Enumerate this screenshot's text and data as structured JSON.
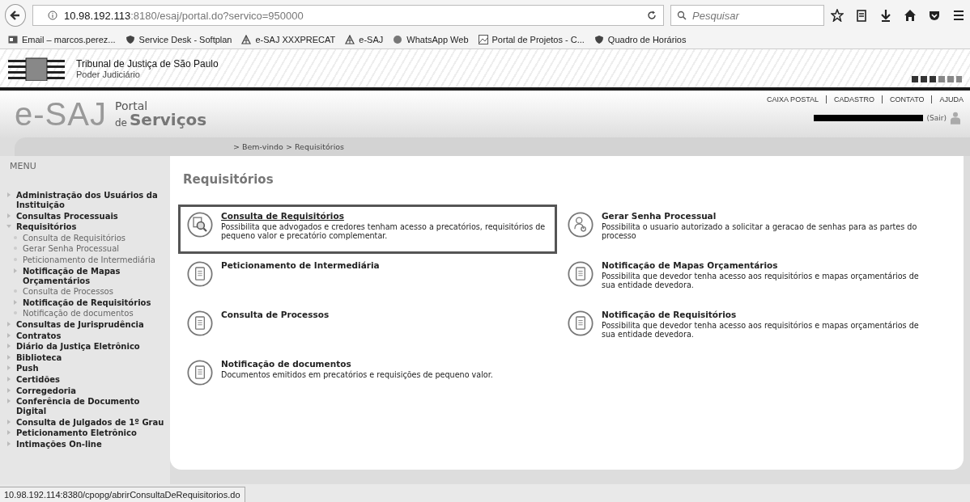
{
  "browser": {
    "url_host": "10.98.192.113",
    "url_rest": ":8180/esaj/portal.do?servico=950000",
    "search": {
      "placeholder": "Pesquisar"
    },
    "bookmarks": [
      {
        "label": "Email – marcos.perez...",
        "kind": "mail"
      },
      {
        "label": "Service Desk - Softplan",
        "kind": "shield"
      },
      {
        "label": "e-SAJ XXXPRECAT",
        "kind": "scale"
      },
      {
        "label": "e-SAJ",
        "kind": "scale"
      },
      {
        "label": "WhatsApp Web",
        "kind": "chat"
      },
      {
        "label": "Portal de Projetos - C...",
        "kind": "image"
      },
      {
        "label": "Quadro de Horários",
        "kind": "shield"
      }
    ]
  },
  "court": {
    "title": "Tribunal de Justiça de São Paulo",
    "subtitle": "Poder Judiciário"
  },
  "portal": {
    "logo": "e-SAJ",
    "logo_small": "Portal",
    "logo_de": "de",
    "logo_big": "Serviços",
    "top_links": [
      "CAIXA POSTAL",
      "CADASTRO",
      "CONTATO",
      "AJUDA"
    ],
    "logout": "(Sair)",
    "breadcrumb": "> Bem-vindo > Requisitórios"
  },
  "menu": {
    "title": "MENU",
    "items": [
      {
        "label": "Administração dos Usuários da Instituição",
        "kind": "folder",
        "expanded": false
      },
      {
        "label": "Consultas Processuais",
        "kind": "folder",
        "expanded": false
      },
      {
        "label": "Requisitórios",
        "kind": "folder",
        "expanded": true,
        "children": [
          {
            "label": "Consulta de Requisitórios",
            "kind": "leaf"
          },
          {
            "label": "Gerar Senha Processual",
            "kind": "leaf"
          },
          {
            "label": "Peticionamento de Intermediária",
            "kind": "leaf"
          },
          {
            "label": "Notificação de Mapas Orçamentários",
            "kind": "folder",
            "expanded": false
          },
          {
            "label": "Consulta de Processos",
            "kind": "leaf"
          },
          {
            "label": "Notificação de Requisitórios",
            "kind": "folder",
            "expanded": false
          },
          {
            "label": "Notificação de documentos",
            "kind": "leaf"
          }
        ]
      },
      {
        "label": "Consultas de Jurisprudência",
        "kind": "folder",
        "expanded": false
      },
      {
        "label": "Contratos",
        "kind": "folder",
        "expanded": false
      },
      {
        "label": "Diário da Justiça Eletrônico",
        "kind": "folder",
        "expanded": false
      },
      {
        "label": "Biblioteca",
        "kind": "folder",
        "expanded": false
      },
      {
        "label": "Push",
        "kind": "folder",
        "expanded": false
      },
      {
        "label": "Certidões",
        "kind": "folder",
        "expanded": false
      },
      {
        "label": "Corregedoria",
        "kind": "folder",
        "expanded": false
      },
      {
        "label": "Conferência de Documento Digital",
        "kind": "folder",
        "expanded": false
      },
      {
        "label": "Consulta de Julgados de 1º Grau",
        "kind": "folder",
        "expanded": false
      },
      {
        "label": "Peticionamento Eletrônico",
        "kind": "folder",
        "expanded": false
      },
      {
        "label": "Intimações On-line",
        "kind": "folder",
        "expanded": false
      }
    ]
  },
  "content": {
    "title": "Requisitórios",
    "services": [
      {
        "title": "Consulta de Requisitórios",
        "description": "Possibilita que advogados e credores tenham acesso a precatórios, requisitórios de pequeno valor e precatório complementar.",
        "kind": "search",
        "selected": true
      },
      {
        "title": "Gerar Senha Processual",
        "description": "Possibilita o usuario autorizado a solicitar a geracao de senhas para as partes do processo",
        "kind": "key",
        "selected": false
      },
      {
        "title": "Peticionamento de Intermediária",
        "kind": "doc",
        "selected": false
      },
      {
        "title": "Notificação de Mapas Orçamentários",
        "description": "Possibilita que devedor tenha acesso aos requisitórios e mapas orçamentários de sua entidade devedora.",
        "kind": "doc",
        "selected": false
      },
      {
        "title": "Consulta de Processos",
        "kind": "doc",
        "selected": false
      },
      {
        "title": "Notificação de Requisitórios",
        "description": "Possibilita que devedor tenha acesso aos requisitórios e mapas orçamentários de sua entidade devedora.",
        "kind": "doc",
        "selected": false
      },
      {
        "title": "Notificação de documentos",
        "description": "Documentos emitidos em precatórios e requisições de pequeno valor.",
        "kind": "doc",
        "selected": false
      }
    ]
  },
  "status_bar": "10.98.192.114:8380/cpopg/abrirConsultaDeRequisitorios.do"
}
